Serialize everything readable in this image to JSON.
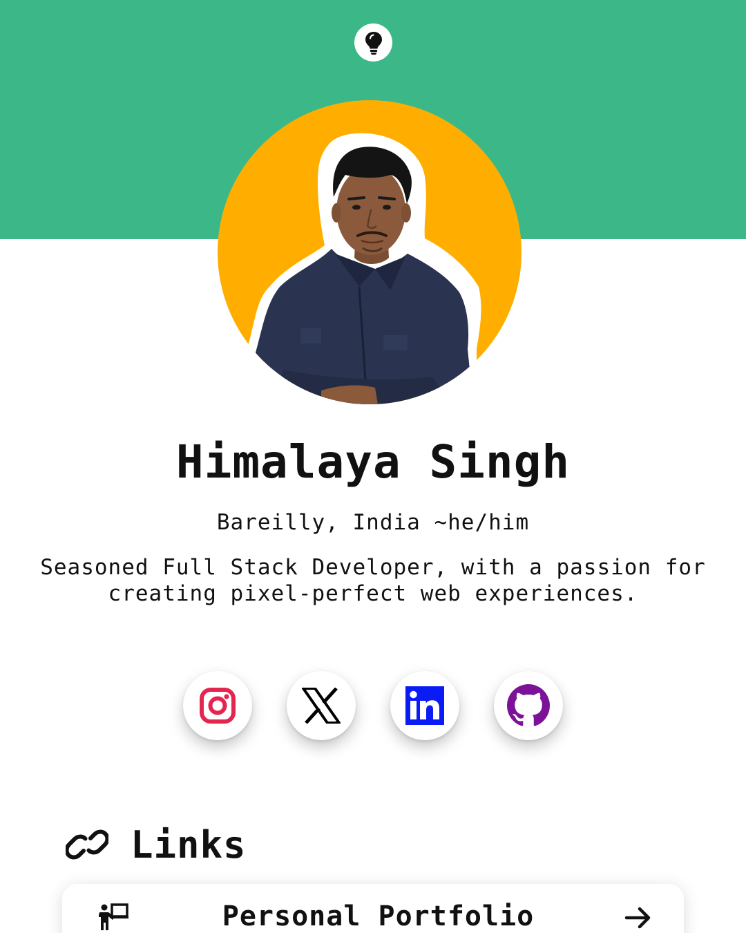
{
  "profile": {
    "name": "Himalaya Singh",
    "location": "Bareilly, India ~he/him",
    "bio": "Seasoned Full Stack Developer, with a passion for creating pixel-perfect web experiences."
  },
  "theme": {
    "banner_color": "#3cb888",
    "avatar_bg_color": "#ffae00"
  },
  "socials": [
    {
      "name": "Instagram",
      "icon": "instagram-icon",
      "color": "#e4264f"
    },
    {
      "name": "X",
      "icon": "x-icon",
      "color": "#000000"
    },
    {
      "name": "LinkedIn",
      "icon": "linkedin-icon",
      "color": "#0a1cf5"
    },
    {
      "name": "GitHub",
      "icon": "github-icon",
      "color": "#7b1298"
    }
  ],
  "links_section": {
    "title": "Links",
    "icon": "link-icon",
    "items": [
      {
        "label": "Personal Portfolio",
        "icon": "presenter-icon",
        "arrow_icon": "arrow-right-icon"
      }
    ]
  },
  "header": {
    "theme_toggle_icon": "lightbulb-icon"
  }
}
